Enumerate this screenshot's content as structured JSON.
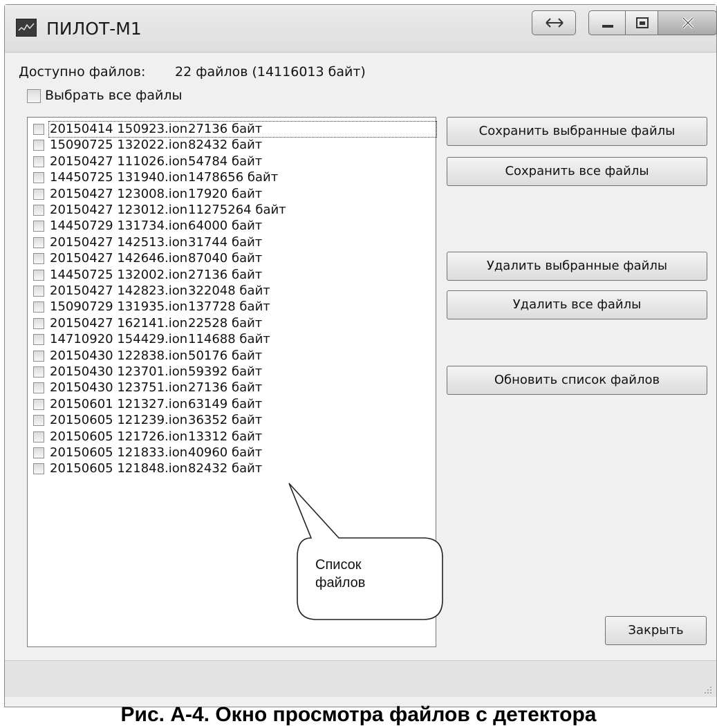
{
  "window": {
    "title": "ПИЛОТ-М1"
  },
  "header": {
    "available_label": "Доступно файлов:",
    "available_value": "22 файлов  (14116013 байт)",
    "select_all_label": "Выбрать все файлы",
    "select_all_checked": false
  },
  "files": [
    {
      "name": "20150414 150923.ion",
      "size": "27136 байт"
    },
    {
      "name": "15090725 132022.ion",
      "size": "82432 байт"
    },
    {
      "name": "20150427 111026.ion",
      "size": "54784 байт"
    },
    {
      "name": "14450725 131940.ion",
      "size": "1478656 байт"
    },
    {
      "name": "20150427 123008.ion",
      "size": "17920 байт"
    },
    {
      "name": "20150427 123012.ion",
      "size": "11275264 байт"
    },
    {
      "name": "14450729 131734.ion",
      "size": "64000 байт"
    },
    {
      "name": "20150427 142513.ion",
      "size": "31744 байт"
    },
    {
      "name": "20150427 142646.ion",
      "size": "87040 байт"
    },
    {
      "name": "14450725 132002.ion",
      "size": "27136 байт"
    },
    {
      "name": "20150427 142823.ion",
      "size": "322048 байт"
    },
    {
      "name": "15090729 131935.ion",
      "size": "137728 байт"
    },
    {
      "name": "20150427 162141.ion",
      "size": "22528 байт"
    },
    {
      "name": "14710920 154429.ion",
      "size": "114688 байт"
    },
    {
      "name": "20150430 122838.ion",
      "size": "50176 байт"
    },
    {
      "name": "20150430 123701.ion",
      "size": "59392 байт"
    },
    {
      "name": "20150430 123751.ion",
      "size": "27136 байт"
    },
    {
      "name": "20150601 121327.ion",
      "size": "63149 байт"
    },
    {
      "name": "20150605 121239.ion",
      "size": "36352 байт"
    },
    {
      "name": "20150605 121726.ion",
      "size": "13312 байт"
    },
    {
      "name": "20150605 121833.ion",
      "size": "40960 байт"
    },
    {
      "name": "20150605 121848.ion",
      "size": "82432 байт"
    }
  ],
  "buttons": {
    "save_selected": "Сохранить выбранные файлы",
    "save_all": "Сохранить все файлы",
    "delete_selected": "Удалить выбранные файлы",
    "delete_all": "Удалить все файлы",
    "refresh": "Обновить список файлов",
    "close": "Закрыть"
  },
  "callout": {
    "line1": "Список",
    "line2": "файлов"
  },
  "caption": "Рис. А-4. Окно просмотра файлов с детектора",
  "icons": {
    "app": "app-icon",
    "snap": "resize-arrows-icon",
    "minimize": "minimize-icon",
    "maximize": "maximize-icon",
    "close": "close-icon",
    "grip": "resize-grip-icon"
  }
}
